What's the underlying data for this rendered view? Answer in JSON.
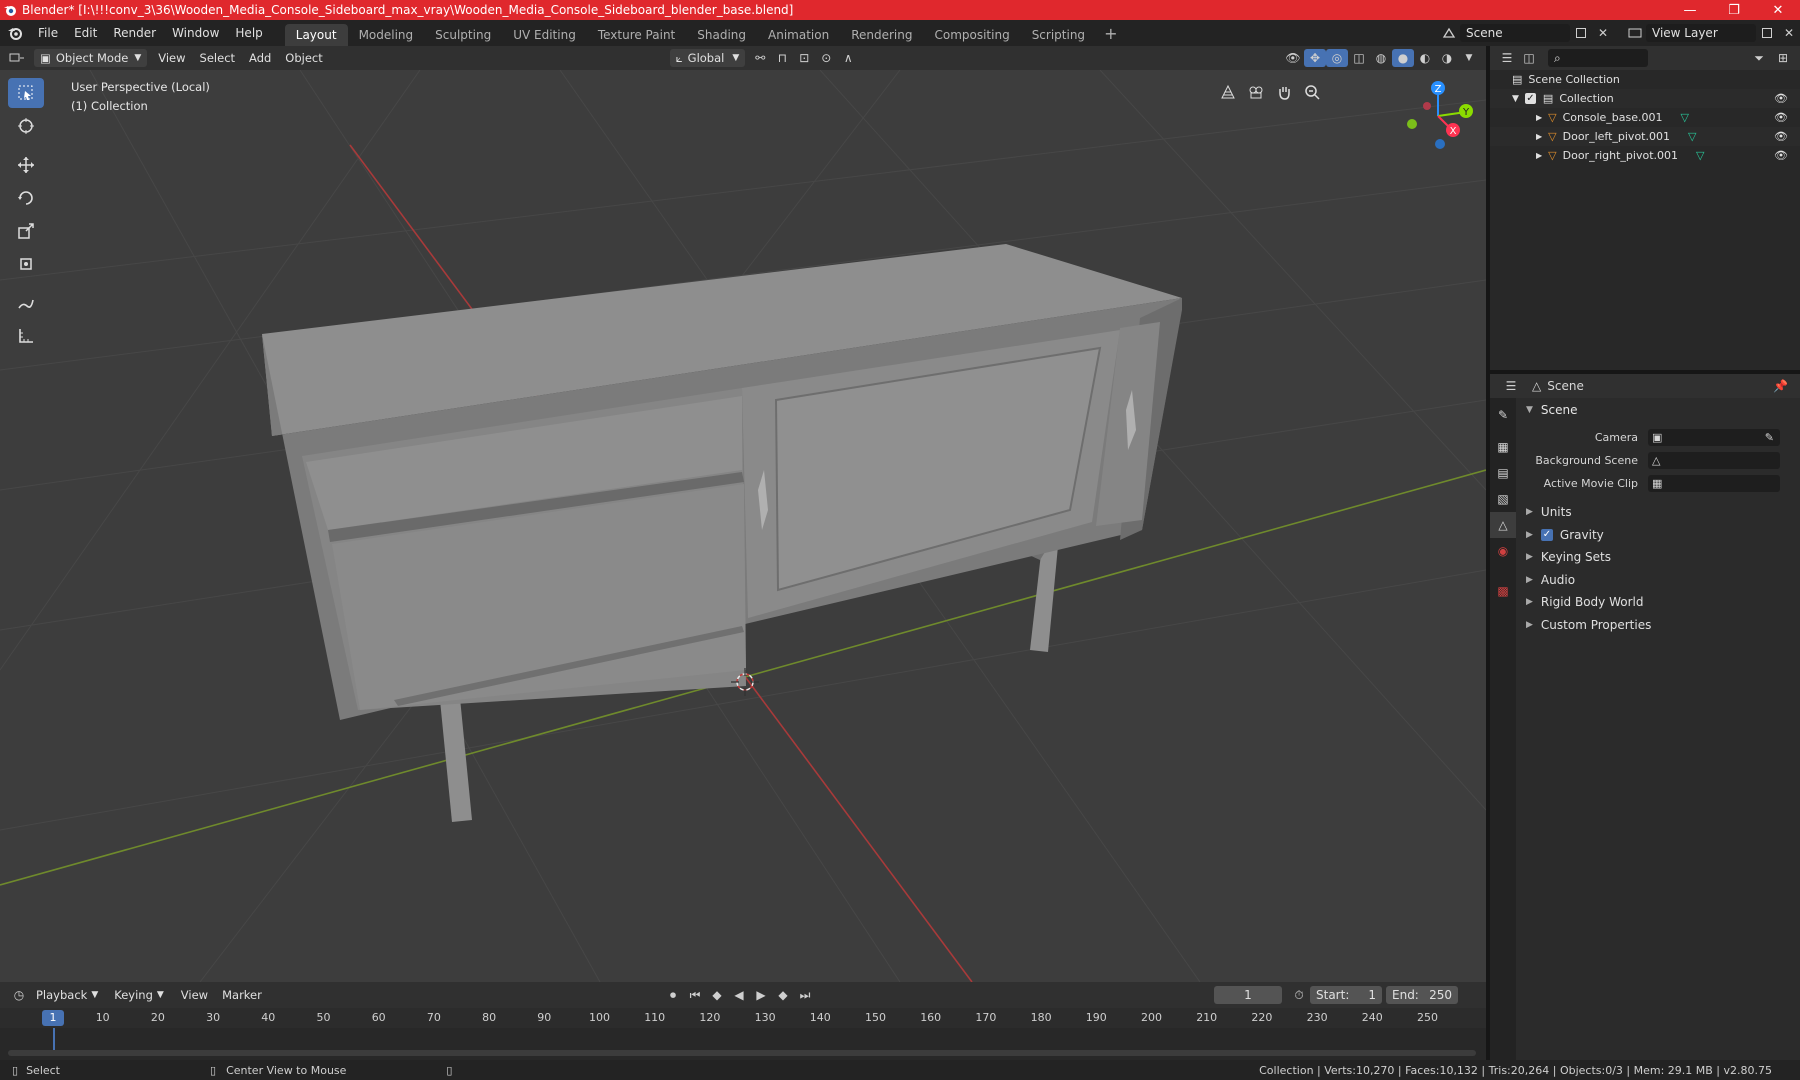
{
  "titlebar": {
    "title": "Blender* [I:\\!!!conv_3\\36\\Wooden_Media_Console_Sideboard_max_vray\\Wooden_Media_Console_Sideboard_blender_base.blend]",
    "minimize": "—",
    "maximize": "❐",
    "close": "✕"
  },
  "menus": [
    "File",
    "Edit",
    "Render",
    "Window",
    "Help"
  ],
  "workspaces": [
    "Layout",
    "Modeling",
    "Sculpting",
    "UV Editing",
    "Texture Paint",
    "Shading",
    "Animation",
    "Rendering",
    "Compositing",
    "Scripting"
  ],
  "workspace_add": "+",
  "scene_selector": {
    "value": "Scene"
  },
  "view_layer": {
    "value": "View Layer"
  },
  "header3d": {
    "mode": "Object Mode",
    "menus": [
      "View",
      "Select",
      "Add",
      "Object"
    ],
    "transform_orientation": "Global"
  },
  "viewport": {
    "perspective_label": "User Perspective (Local)",
    "collection_label": "(1) Collection",
    "axis_labels": {
      "z": "Z",
      "y": "Y",
      "x": "X"
    }
  },
  "outliner": {
    "root": "Scene Collection",
    "collection": "Collection",
    "objects": [
      "Console_base.001",
      "Door_left_pivot.001",
      "Door_right_pivot.001"
    ]
  },
  "properties": {
    "header": "Scene",
    "panel": "Scene",
    "rows": [
      {
        "label": "Camera",
        "value": ""
      },
      {
        "label": "Background Scene",
        "value": ""
      },
      {
        "label": "Active Movie Clip",
        "value": ""
      }
    ],
    "subpanels": [
      "Units",
      "Gravity",
      "Keying Sets",
      "Audio",
      "Rigid Body World",
      "Custom Properties"
    ],
    "gravity_checked": "✓"
  },
  "timeline": {
    "menus": [
      "Playback",
      "Keying",
      "View",
      "Marker"
    ],
    "current_frame": "1",
    "start_label": "Start:",
    "start": "1",
    "end_label": "End:",
    "end": "250",
    "ticks": [
      "10",
      "20",
      "30",
      "40",
      "50",
      "60",
      "70",
      "80",
      "90",
      "100",
      "110",
      "120",
      "130",
      "140",
      "150",
      "160",
      "170",
      "180",
      "190",
      "200",
      "210",
      "220",
      "230",
      "240",
      "250"
    ],
    "marker": "1"
  },
  "statusbar": {
    "select": "Select",
    "center": "Center View to Mouse",
    "stats": "Collection | Verts:10,270 | Faces:10,132 | Tris:20,264 | Objects:0/3 | Mem: 29.1 MB | v2.80.75"
  },
  "colors": {
    "titlebar": "#e0282d",
    "accent": "#4772b3",
    "x_axis": "#ff3352",
    "y_axis": "#8bdc00",
    "z_axis": "#2890ff",
    "mesh_icon": "#e08e2b"
  }
}
